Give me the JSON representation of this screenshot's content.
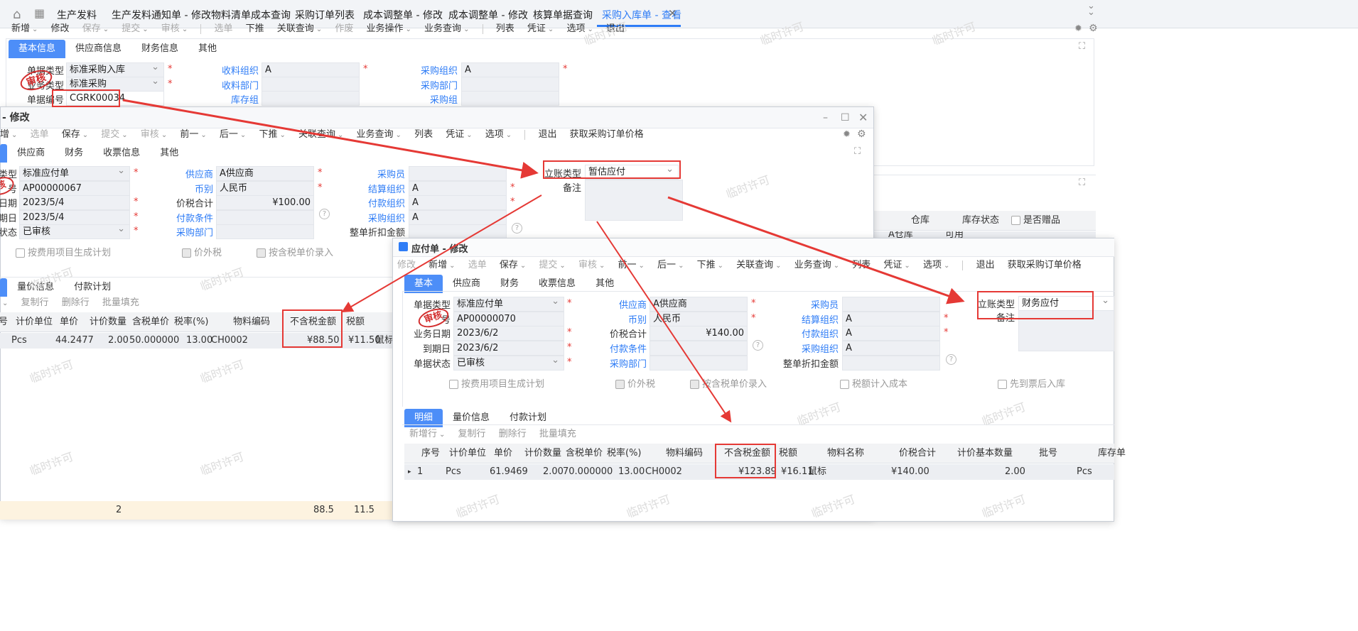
{
  "tabbar": {
    "home_icon": "home-icon",
    "apps_icon": "apps-grid-icon",
    "tabs": [
      "生产发料",
      "生产发料通知单 - 修改",
      "物料清单成本查询",
      "采购订单列表",
      "成本调整单 - 修改",
      "成本调整单 - 修改",
      "核算单据查询",
      "采购入库单 - 查看"
    ],
    "close_icon": "×",
    "collapse_icon": "⌄⌄"
  },
  "main_toolbar": [
    "新增",
    "修改",
    "保存",
    "提交",
    "审核",
    "选单",
    "下推",
    "关联查询",
    "作废",
    "业务操作",
    "业务查询",
    "列表",
    "凭证",
    "选项",
    "退出"
  ],
  "main_form": {
    "subtabs": [
      "基本信息",
      "供应商信息",
      "财务信息",
      "其他"
    ],
    "labels": {
      "doc_type": "单据类型",
      "biz_type": "业务类型",
      "doc_no": "单据编号",
      "recv_org": "收料组织",
      "recv_dept": "收料部门",
      "stock_group": "库存组",
      "pur_org": "采购组织",
      "pur_dept": "采购部门",
      "pur_group": "采购组"
    },
    "values": {
      "doc_type": "标准采购入库",
      "biz_type": "标准采购",
      "doc_no": "CGRK00034",
      "recv_org": "A",
      "pur_org": "A"
    },
    "stamp": "审核",
    "right_grid_headers": [
      "仓库",
      "库存状态",
      "是否赠品"
    ],
    "right_grid_row": [
      "A仓库",
      "可用"
    ]
  },
  "win1": {
    "title": "- 修改",
    "toolbar": [
      "增",
      "选单",
      "保存",
      "提交",
      "审核",
      "前一",
      "后一",
      "下推",
      "关联查询",
      "业务查询",
      "列表",
      "凭证",
      "选项",
      "退出",
      "获取采购订单价格"
    ],
    "subtabs": [
      "供应商",
      "财务",
      "收票信息",
      "其他"
    ],
    "labels": {
      "doc_type": "单据类型",
      "doc_no": "号",
      "biz_date": "业务日期",
      "due_date": "到期日",
      "status": "单据状态",
      "supplier": "供应商",
      "currency": "币别",
      "total": "价税合计",
      "pay_term": "付款条件",
      "pur_dept": "采购部门",
      "buyer": "采购员",
      "settle_org": "结算组织",
      "pay_org": "付款组织",
      "pur_org": "采购组织",
      "discount": "整单折扣金额",
      "acct_type": "立账类型",
      "remark": "备注"
    },
    "values": {
      "doc_type": "标准应付单",
      "doc_no": "AP00000067",
      "biz_date": "2023/5/4",
      "due_date": "2023/5/4",
      "status": "已审核",
      "supplier": "A供应商",
      "currency": "人民币",
      "total": "¥100.00",
      "settle_org": "A",
      "pay_org": "A",
      "pur_org": "A",
      "acct_type": "暂估应付"
    },
    "checks": [
      "按费用项目生成计划",
      "价外税",
      "按含税单价录入"
    ],
    "detail_tabs": [
      "量价信息",
      "付款计划"
    ],
    "detail_toolbar": [
      "行",
      "复制行",
      "删除行",
      "批量填充"
    ],
    "grid_headers": [
      "号",
      "计价单位",
      "单价",
      "计价数量",
      "含税单价",
      "税率(%)",
      "物料编码",
      "不含税金额",
      "税额"
    ],
    "grid_row": [
      "Pcs",
      "44.2477",
      "2.00",
      "50.000000",
      "13.00",
      "CH0002",
      "¥88.50",
      "¥11.50",
      "鼠标"
    ],
    "footer": [
      "2",
      "88.5",
      "11.5"
    ]
  },
  "win2": {
    "title": "应付单 - 修改",
    "toolbar": [
      "修改",
      "新增",
      "选单",
      "保存",
      "提交",
      "审核",
      "前一",
      "后一",
      "下推",
      "关联查询",
      "业务查询",
      "列表",
      "凭证",
      "选项",
      "退出",
      "获取采购订单价格"
    ],
    "subtabs": [
      "基本",
      "供应商",
      "财务",
      "收票信息",
      "其他"
    ],
    "labels": {
      "doc_type": "单据类型",
      "doc_no": "号",
      "biz_date": "业务日期",
      "due_date": "到期日",
      "status": "单据状态",
      "supplier": "供应商",
      "currency": "币别",
      "total": "价税合计",
      "pay_term": "付款条件",
      "pur_dept": "采购部门",
      "buyer": "采购员",
      "settle_org": "结算组织",
      "pay_org": "付款组织",
      "pur_org": "采购组织",
      "discount": "整单折扣金额",
      "acct_type": "立账类型",
      "remark": "备注"
    },
    "values": {
      "doc_type": "标准应付单",
      "doc_no": "AP00000070",
      "biz_date": "2023/6/2",
      "due_date": "2023/6/2",
      "status": "已审核",
      "supplier": "A供应商",
      "currency": "人民币",
      "total": "¥140.00",
      "settle_org": "A",
      "pay_org": "A",
      "pur_org": "A",
      "acct_type": "财务应付"
    },
    "checks": [
      "按费用项目生成计划",
      "价外税",
      "按含税单价录入",
      "税额计入成本",
      "先到票后入库"
    ],
    "detail_tabs": [
      "明细",
      "量价信息",
      "付款计划"
    ],
    "detail_toolbar": [
      "新增行",
      "复制行",
      "删除行",
      "批量填充"
    ],
    "grid_headers": [
      "序号",
      "计价单位",
      "单价",
      "计价数量",
      "含税单价",
      "税率(%)",
      "物料编码",
      "不含税金额",
      "税额",
      "物料名称",
      "价税合计",
      "计价基本数量",
      "批号",
      "库存单"
    ],
    "grid_row": [
      "1",
      "Pcs",
      "61.9469",
      "2.00",
      "70.000000",
      "13.00",
      "CH0002",
      "¥123.89",
      "¥16.11",
      "鼠标",
      "¥140.00",
      "2.00",
      "",
      "Pcs"
    ]
  },
  "watermark": "临时许可",
  "accent": "#2e7cf6",
  "annotation_color": "#e53935"
}
